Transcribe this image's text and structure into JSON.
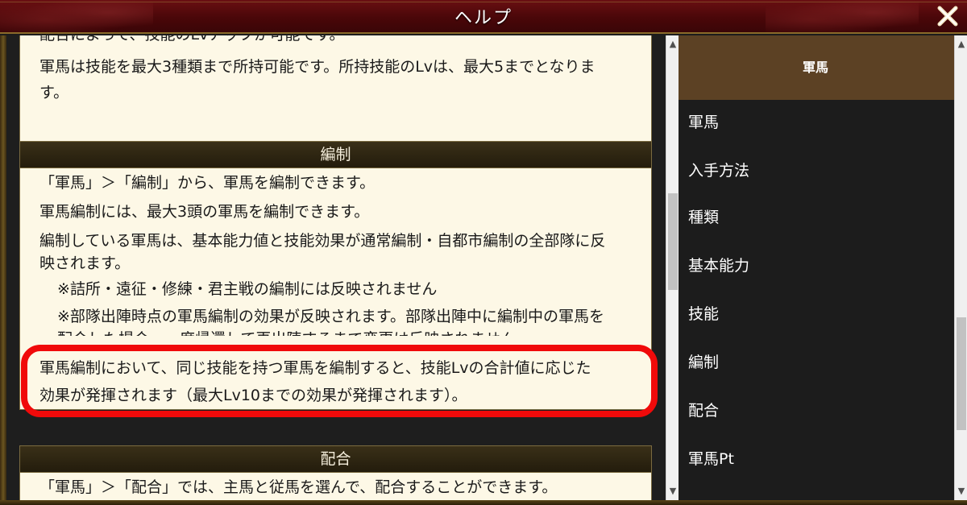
{
  "window": {
    "title": "ヘルプ",
    "close_icon": "close-icon"
  },
  "content": {
    "top_section": {
      "lines": [
        "配合によって、技能のLvアップが可能です。",
        "軍馬は技能を最大3種類まで所持可能です。所持技能のLvは、最大5までとなりま",
        "す。"
      ]
    },
    "editing_section": {
      "header": "編制",
      "lines": [
        "「軍馬」＞「編制」から、軍馬を編制できます。",
        "軍馬編制には、最大3頭の軍馬を編制できます。",
        "編制している軍馬は、基本能力値と技能効果が通常編制・自都市編制の全部隊に反",
        "映されます。",
        "※詰所・遠征・修練・君主戦の編制には反映されません",
        "※部隊出陣時点の軍馬編制の効果が反映されます。部隊出陣中に編制中の軍馬を",
        "配合した場合、一度帰還して再出陣するまで変更は反映されません",
        "軍馬編制において、同じ技能を持つ軍馬を編制すると、技能Lvの合計値に応じた",
        "効果が発揮されます（最大Lv10までの効果が発揮されます）。"
      ]
    },
    "breeding_section": {
      "header": "配合",
      "lines": [
        "「軍馬」＞「配合」では、主馬と従馬を選んで、配合することができます。"
      ]
    },
    "highlight_color": "#f00a0a"
  },
  "sidebar": {
    "header": "軍馬",
    "items": [
      {
        "label": "軍馬"
      },
      {
        "label": "入手方法"
      },
      {
        "label": "種類"
      },
      {
        "label": "基本能力"
      },
      {
        "label": "技能"
      },
      {
        "label": "編制"
      },
      {
        "label": "配合"
      },
      {
        "label": "軍馬Pt"
      }
    ]
  },
  "colors": {
    "titlebar": "#4a0709",
    "panel_bg": "#fdf8e6",
    "section_header": "#2a2210",
    "sidebar_header": "#5c4124",
    "sidebar_bg": "#1c1c1c"
  }
}
